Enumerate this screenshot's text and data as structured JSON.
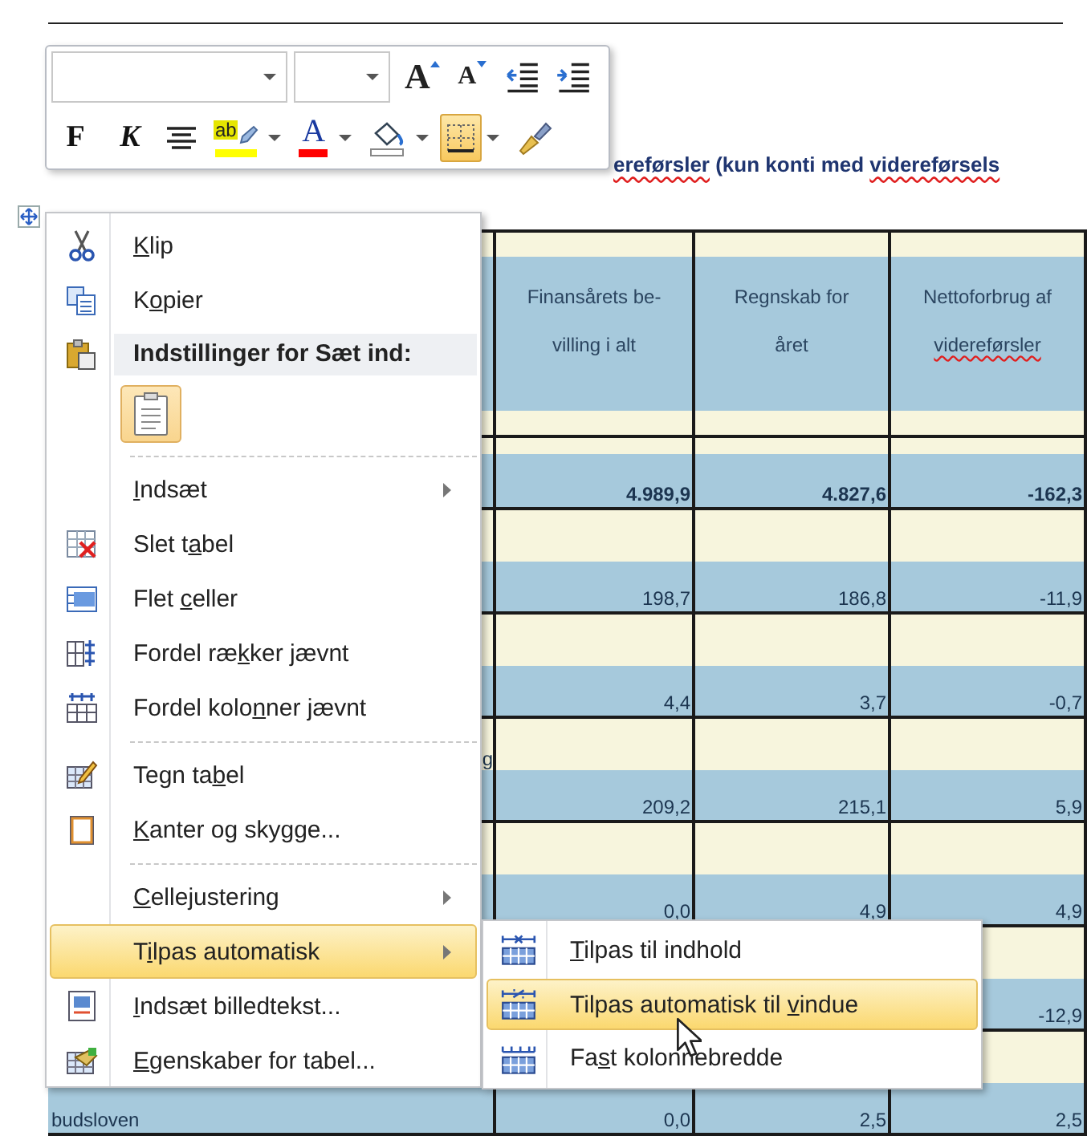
{
  "toolbar": {
    "rows": [
      [
        {
          "kind": "font_name"
        },
        {
          "kind": "font_size"
        },
        {
          "kind": "grow_font",
          "label": "A",
          "selected": false
        },
        {
          "kind": "shrink_font",
          "label": "A",
          "selected": false
        },
        {
          "kind": "outdent",
          "selected": false
        },
        {
          "kind": "indent",
          "selected": false
        }
      ],
      [
        {
          "kind": "bold",
          "label": "F",
          "selected": false
        },
        {
          "kind": "italic",
          "label": "K",
          "selected": false
        },
        {
          "kind": "center",
          "selected": false
        },
        {
          "kind": "highlight",
          "label": "ab",
          "color": "#ffff00",
          "selected": false
        },
        {
          "kind": "font_color",
          "label": "A",
          "color": "#ff0000",
          "selected": false
        },
        {
          "kind": "shading",
          "selected": false
        },
        {
          "kind": "borders",
          "selected": true
        },
        {
          "kind": "format_painter",
          "selected": false
        }
      ]
    ]
  },
  "heading": {
    "segments": [
      {
        "text": "ereførsler",
        "misspelled": true
      },
      {
        "text": " (kun konti med ",
        "misspelled": false
      },
      {
        "text": "videreførsels",
        "misspelled": true
      }
    ]
  },
  "table": {
    "header": [
      {
        "lines": [
          {
            "text": "Finansårets be-",
            "misspelled": false
          },
          {
            "text": "villing  i alt",
            "misspelled": false
          }
        ]
      },
      {
        "lines": [
          {
            "text": "Regnskab for",
            "misspelled": false
          },
          {
            "text": "året",
            "misspelled": false
          }
        ]
      },
      {
        "lines": [
          {
            "text": "Nettoforbrug af",
            "misspelled": false
          },
          {
            "text": "videreførsler",
            "misspelled": true
          }
        ]
      }
    ],
    "rows": [
      {
        "kind": "total",
        "cells": {
          "column_2": "4.989,9",
          "column_3": "4.827,6",
          "column_4": "-162,3"
        }
      },
      {
        "kind": "line",
        "cells": {
          "column_2": "198,7",
          "column_3": "186,8",
          "column_4": "-11,9"
        }
      },
      {
        "kind": "line",
        "cells": {
          "column_2": "4,4",
          "column_3": "3,7",
          "column_4": "-0,7"
        }
      },
      {
        "kind": "line",
        "column_1_top": "g",
        "cells": {
          "column_2": "209,2",
          "column_3": "215,1",
          "column_4": "5,9"
        }
      },
      {
        "kind": "line",
        "cells": {
          "column_2": "0,0",
          "column_3": "4,9",
          "column_4": "4,9"
        }
      },
      {
        "kind": "line",
        "cells": {
          "column_4": "-12,9"
        }
      },
      {
        "kind": "line",
        "column_1": "budsloven",
        "cells": {
          "column_2": "0,0",
          "column_3": "2,5",
          "column_4": "2,5"
        }
      }
    ]
  },
  "menu": {
    "items": [
      {
        "kind": "item",
        "key": "K",
        "after": "lip",
        "submenu": false,
        "selected": false
      },
      {
        "kind": "item",
        "before": "K",
        "key": "o",
        "after": "pier",
        "submenu": false,
        "selected": false
      },
      {
        "kind": "header",
        "text": "Indstillinger for Sæt ind:"
      },
      {
        "kind": "paste_option"
      },
      {
        "kind": "separator"
      },
      {
        "kind": "item",
        "key": "I",
        "after": "ndsæt",
        "submenu": true,
        "selected": false
      },
      {
        "kind": "item",
        "before": "Slet t",
        "key": "a",
        "after": "bel",
        "submenu": false,
        "selected": false
      },
      {
        "kind": "item",
        "before": "Flet ",
        "key": "c",
        "after": "eller",
        "submenu": false,
        "selected": false
      },
      {
        "kind": "item",
        "before": "Fordel ræ",
        "key": "k",
        "after": "ker jævnt",
        "submenu": false,
        "selected": false
      },
      {
        "kind": "item",
        "before": "Fordel kolo",
        "key": "n",
        "after": "ner jævnt",
        "submenu": false,
        "selected": false
      },
      {
        "kind": "separator"
      },
      {
        "kind": "item",
        "before": "Tegn ta",
        "key": "b",
        "after": "el",
        "submenu": false,
        "selected": false
      },
      {
        "kind": "item",
        "key": "K",
        "after": "anter og skygge...",
        "submenu": false,
        "selected": false
      },
      {
        "kind": "separator"
      },
      {
        "kind": "item",
        "key": "C",
        "after": "ellejustering",
        "submenu": true,
        "selected": false
      },
      {
        "kind": "item",
        "before": "T",
        "key": "i",
        "after": "lpas automatisk",
        "submenu": true,
        "selected": true
      },
      {
        "kind": "item",
        "key": "I",
        "after": "ndsæt billedtekst...",
        "submenu": false,
        "selected": false
      },
      {
        "kind": "item",
        "key": "E",
        "after": "genskaber for tabel...",
        "submenu": false,
        "selected": false
      }
    ]
  },
  "submenu": {
    "items": [
      {
        "key": "T",
        "after": "ilpas til indhold",
        "selected": false
      },
      {
        "before": "Tilpas automatisk til ",
        "key": "v",
        "after": "indue",
        "selected": true
      },
      {
        "before": "Fa",
        "key": "s",
        "after": "t kolonnebredde",
        "selected": false
      }
    ]
  }
}
